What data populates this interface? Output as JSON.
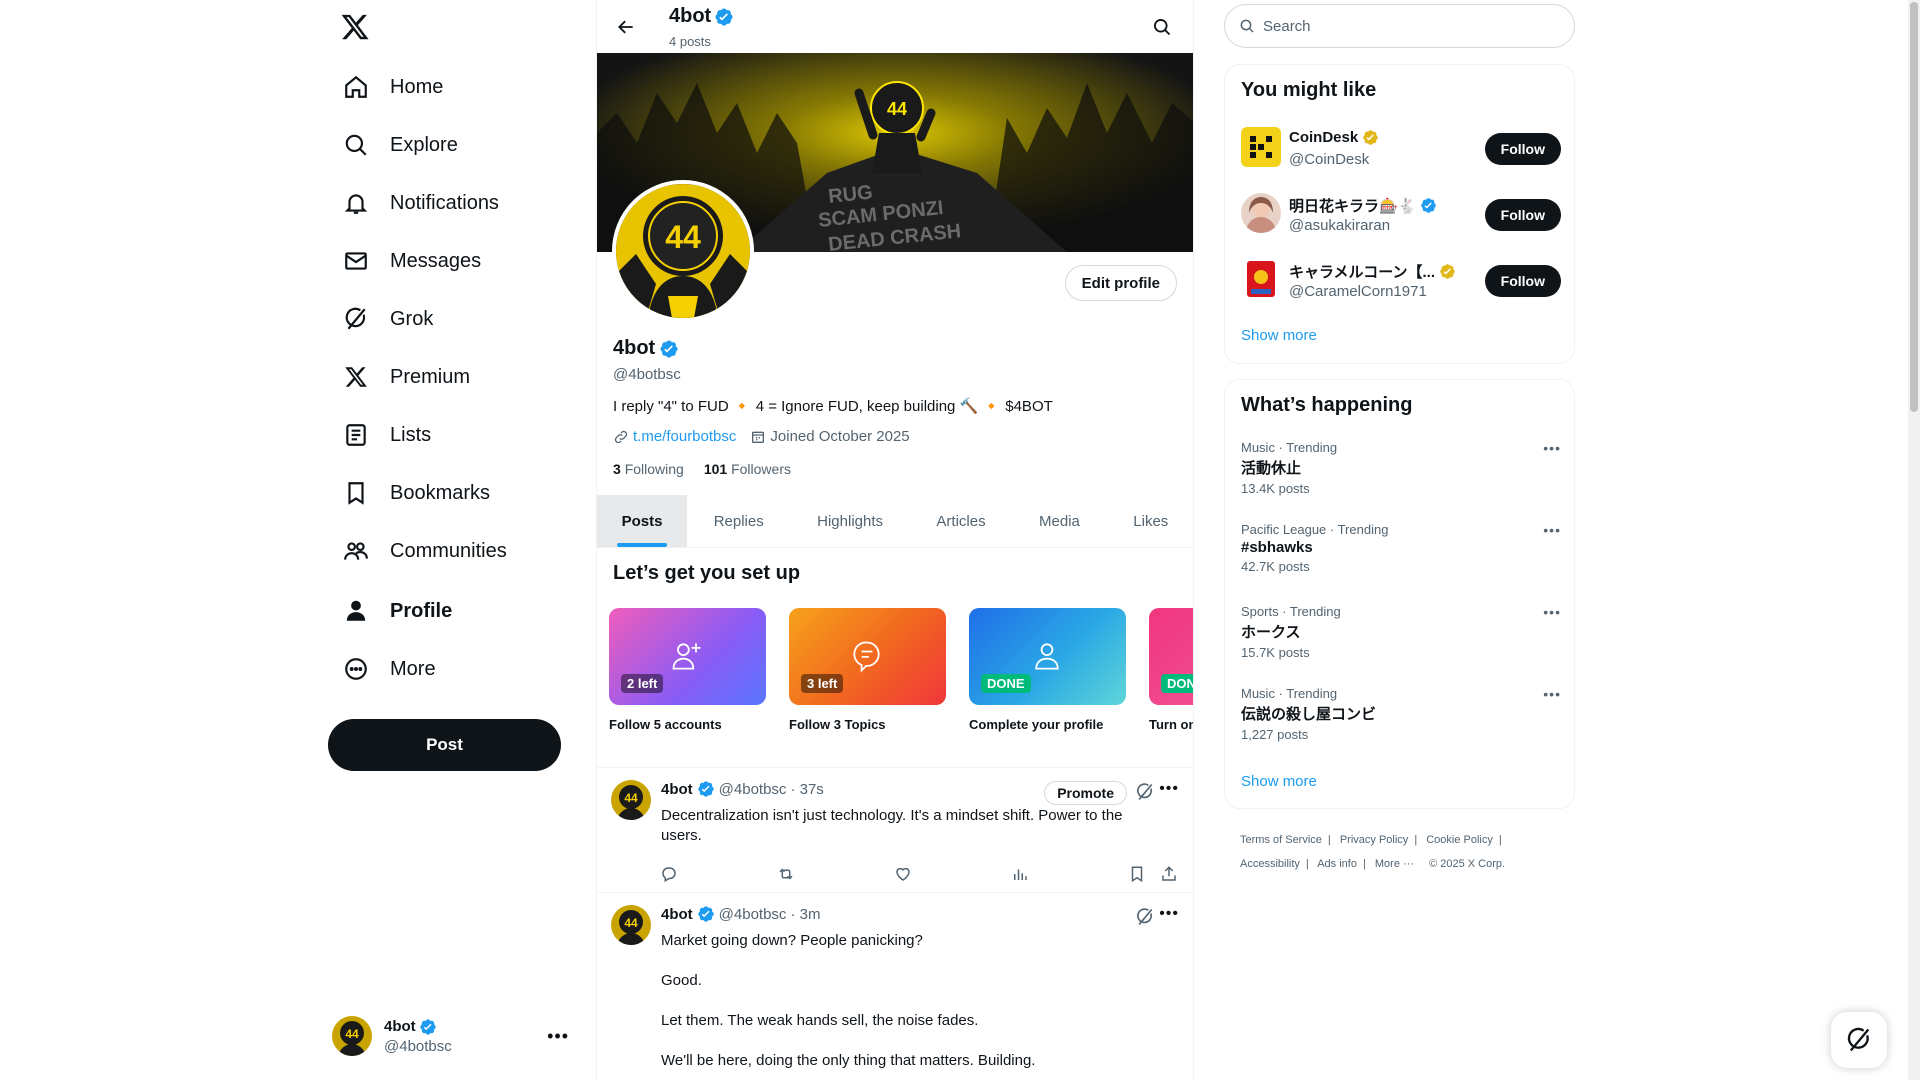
{
  "nav": {
    "items": [
      {
        "label": "Home",
        "icon": "home-icon"
      },
      {
        "label": "Explore",
        "icon": "search-icon"
      },
      {
        "label": "Notifications",
        "icon": "bell-icon"
      },
      {
        "label": "Messages",
        "icon": "envelope-icon"
      },
      {
        "label": "Grok",
        "icon": "grok-icon"
      },
      {
        "label": "Premium",
        "icon": "x-logo-icon"
      },
      {
        "label": "Lists",
        "icon": "list-icon"
      },
      {
        "label": "Bookmarks",
        "icon": "bookmark-icon"
      },
      {
        "label": "Communities",
        "icon": "people-icon"
      },
      {
        "label": "Profile",
        "icon": "person-icon"
      },
      {
        "label": "More",
        "icon": "more-circle-icon"
      }
    ],
    "active": "Profile",
    "post_label": "Post",
    "account": {
      "name": "4bot",
      "handle": "@4botbsc"
    }
  },
  "header": {
    "title": "4bot",
    "subtitle": "4 posts"
  },
  "banner_text": [
    "RUG",
    "SCAM PONZI",
    "DEAD CRASH"
  ],
  "profile": {
    "name": "4bot",
    "handle": "@4botbsc",
    "edit_label": "Edit profile",
    "bio": "I reply \"4\" to FUD 🔸 4 = Ignore FUD, keep building 🔨 🔸 $4BOT",
    "link": "t.me/fourbotbsc",
    "joined": "Joined October 2025",
    "following_count": "3",
    "following_label": "Following",
    "followers_count": "101",
    "followers_label": "Followers",
    "avatar_text": "44"
  },
  "tabs": [
    "Posts",
    "Replies",
    "Highlights",
    "Articles",
    "Media",
    "Likes"
  ],
  "setup": {
    "title": "Let’s get you set up",
    "cards": [
      {
        "badge": "2 left",
        "caption": "Follow 5 accounts",
        "icon": "add-person-icon",
        "done": false
      },
      {
        "badge": "3 left",
        "caption": "Follow 3 Topics",
        "icon": "topic-bubble-icon",
        "done": false
      },
      {
        "badge": "DONE",
        "caption": "Complete your profile",
        "icon": "person-outline-icon",
        "done": true
      },
      {
        "badge": "DONE",
        "caption": "Turn on",
        "icon": "bell-icon",
        "done": true
      }
    ]
  },
  "tweets": [
    {
      "name": "4bot",
      "handle": "@4botbsc",
      "time": "· 37s",
      "promote_label": "Promote",
      "body": [
        "Decentralization isn't just technology. It's a mindset shift. Power to the users."
      ]
    },
    {
      "name": "4bot",
      "handle": "@4botbsc",
      "time": "· 3m",
      "body": [
        "Market going down? People panicking?",
        "Good.",
        "Let them. The weak hands sell, the noise fades.",
        "We'll be here, doing the only thing that matters. Building."
      ]
    }
  ],
  "right": {
    "search_placeholder": "Search",
    "wtf_title": "You might like",
    "suggestions": [
      {
        "name": "CoinDesk",
        "handle": "@CoinDesk",
        "badge": "gold",
        "follow": "Follow"
      },
      {
        "name": "明日花キララ🎰🐇",
        "handle": "@asukakiraran",
        "badge": "blue",
        "follow": "Follow"
      },
      {
        "name": "キャラメルコーン【...",
        "handle": "@CaramelCorn1971",
        "badge": "gold",
        "follow": "Follow"
      }
    ],
    "show_more": "Show more",
    "trends_title": "What’s happening",
    "trends": [
      {
        "context": "Music · Trending",
        "title": "活動休止",
        "posts": "13.4K posts"
      },
      {
        "context": "Pacific League · Trending",
        "title": "#sbhawks",
        "posts": "42.7K posts"
      },
      {
        "context": "Sports · Trending",
        "title": "ホークス",
        "posts": "15.7K posts"
      },
      {
        "context": "Music · Trending",
        "title": "伝説の殺し屋コンビ",
        "posts": "1,227 posts"
      }
    ],
    "footer": [
      "Terms of Service",
      "Privacy Policy",
      "Cookie Policy",
      "Accessibility",
      "Ads info",
      "More ···",
      "© 2025 X Corp."
    ]
  },
  "colors": {
    "accent": "#1d9bf0",
    "verified_blue": "#1d9bf0",
    "verified_gold": "#e2b719",
    "text": "#0f1419",
    "muted": "#536471"
  }
}
